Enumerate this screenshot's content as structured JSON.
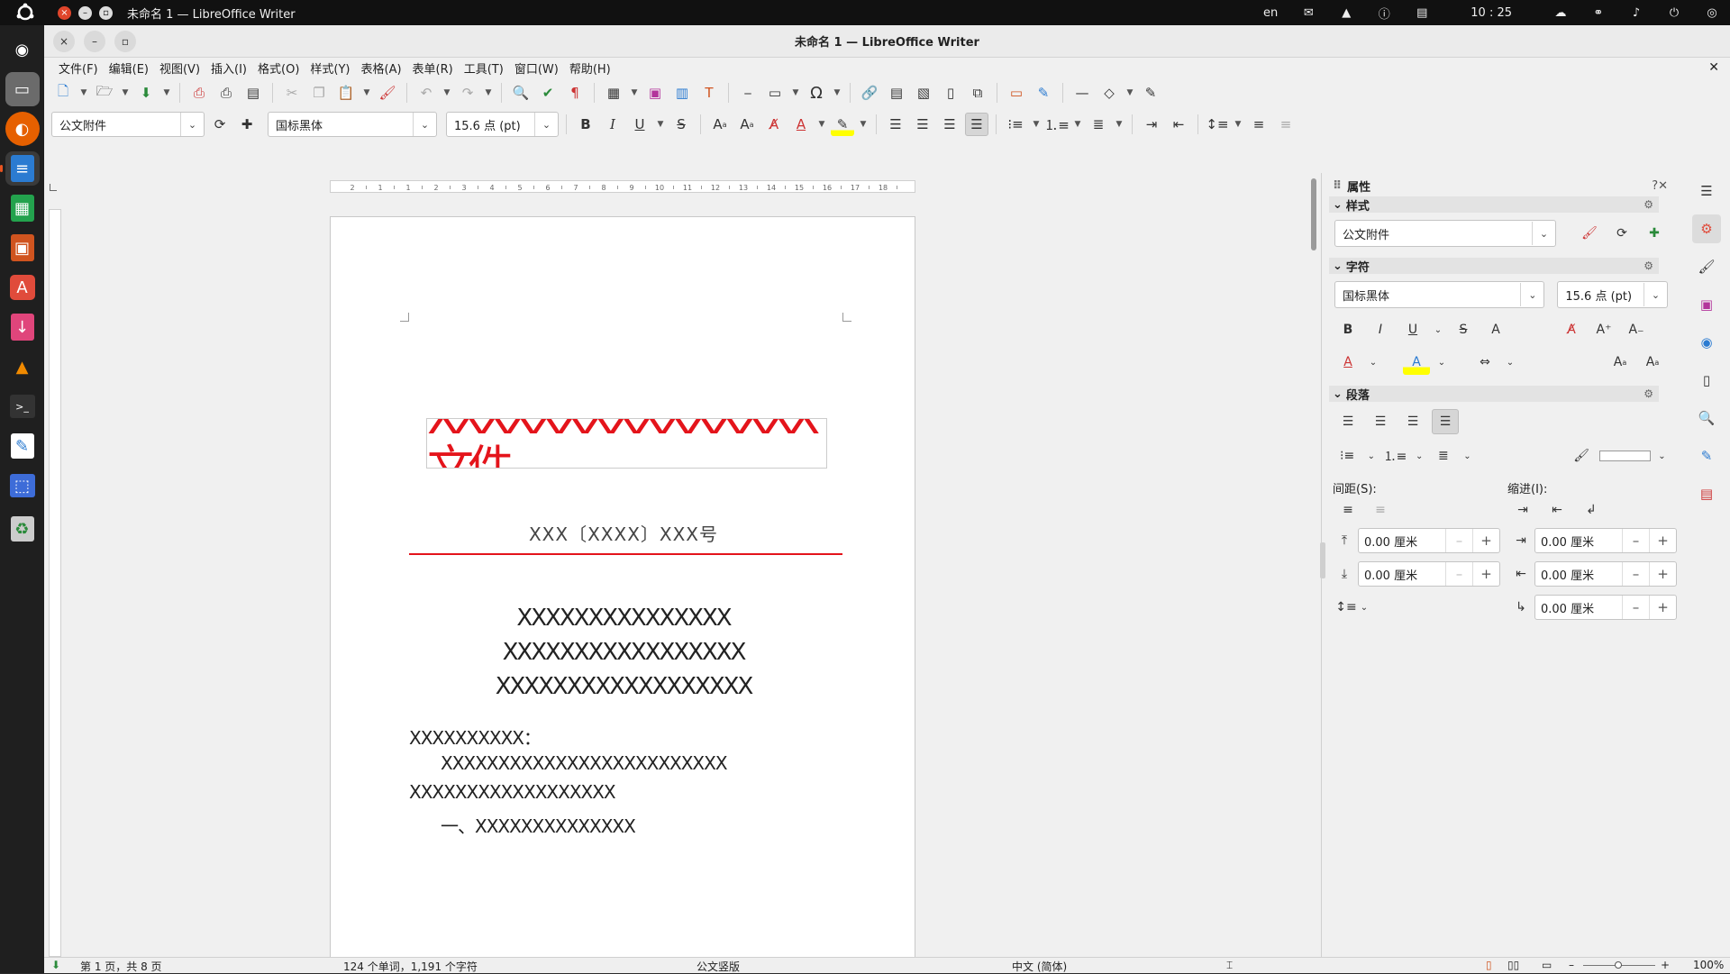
{
  "system_bar": {
    "window_title": "未命名 1 — LibreOffice Writer",
    "language": "en",
    "clock": "10 : 25"
  },
  "dock": {
    "apps": [
      "ubuntu",
      "files",
      "firefox",
      "writer",
      "calc",
      "impress",
      "software",
      "installer",
      "vlc",
      "terminal",
      "text-editor",
      "screenshot",
      "trash"
    ]
  },
  "titlebar": {
    "title": "未命名 1 — LibreOffice Writer"
  },
  "menubar": {
    "items": [
      "文件(F)",
      "编辑(E)",
      "视图(V)",
      "插入(I)",
      "格式(O)",
      "样式(Y)",
      "表格(A)",
      "表单(R)",
      "工具(T)",
      "窗口(W)",
      "帮助(H)"
    ]
  },
  "formatting": {
    "paragraph_style": "公文附件",
    "font_name": "国标黑体",
    "font_size": "15.6 点 (pt)"
  },
  "ruler": {
    "ticks": [
      "2",
      "1",
      "1",
      "2",
      "3",
      "4",
      "5",
      "6",
      "7",
      "8",
      "9",
      "10",
      "11",
      "12",
      "13",
      "14",
      "15",
      "16",
      "17",
      "18"
    ]
  },
  "document": {
    "red_header": "XXXXXXXXXXXXXXX文件",
    "doc_number": "XXX〔XXXX〕XXX号",
    "title_lines": [
      "XXXXXXXXXXXXXXX",
      "XXXXXXXXXXXXXXXXX",
      "XXXXXXXXXXXXXXXXXX"
    ],
    "salutation": "XXXXXXXXXX：",
    "body_line_1": "XXXXXXXXXXXXXXXXXXXXXXXXX",
    "body_line_2": "XXXXXXXXXXXXXXXXXX",
    "section_1": "一、XXXXXXXXXXXXXX",
    "colors": {
      "red": "#e4141b"
    }
  },
  "sidebar": {
    "title": "属性",
    "sections": {
      "style": "样式",
      "character": "字符",
      "paragraph": "段落"
    },
    "style_value": "公文附件",
    "font_value": "国标黑体",
    "size_value": "15.6 点 (pt)",
    "spacing_label": "间距(S):",
    "indent_label": "缩进(I):",
    "spacing_above": "0.00 厘米",
    "spacing_below": "0.00 厘米",
    "indent_before": "0.00 厘米",
    "indent_after": "0.00 厘米",
    "indent_first": "0.00 厘米"
  },
  "statusbar": {
    "page": "第 1 页，共 8 页",
    "words": "124 个单词，1,191 个字符",
    "page_style": "公文竖版",
    "language": "中文 (简体)",
    "zoom": "100%"
  }
}
